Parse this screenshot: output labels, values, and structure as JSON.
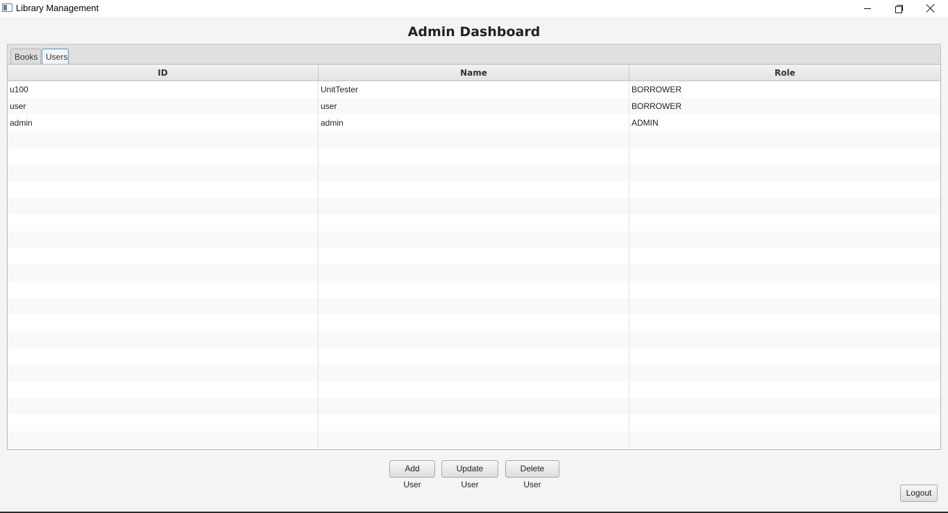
{
  "window": {
    "title": "Library Management",
    "controls": {
      "minimize": "minimize-icon",
      "maximize": "restore-icon",
      "close": "close-icon"
    }
  },
  "page": {
    "title": "Admin Dashboard"
  },
  "tabs": [
    {
      "label": "Books",
      "selected": false
    },
    {
      "label": "Users",
      "selected": true
    }
  ],
  "table": {
    "columns": [
      "ID",
      "Name",
      "Role"
    ],
    "rows": [
      [
        "u100",
        "UnitTester",
        "BORROWER"
      ],
      [
        "user",
        "user",
        "BORROWER"
      ],
      [
        "admin",
        "admin",
        "ADMIN"
      ]
    ],
    "empty_rows": 19
  },
  "actions": {
    "add": "Add User",
    "update": "Update User",
    "delete": "Delete User",
    "logout": "Logout"
  },
  "colors": {
    "background": "#f4f4f4",
    "tab_focus": "#3a9bd8",
    "header": "#e3e3e3"
  }
}
